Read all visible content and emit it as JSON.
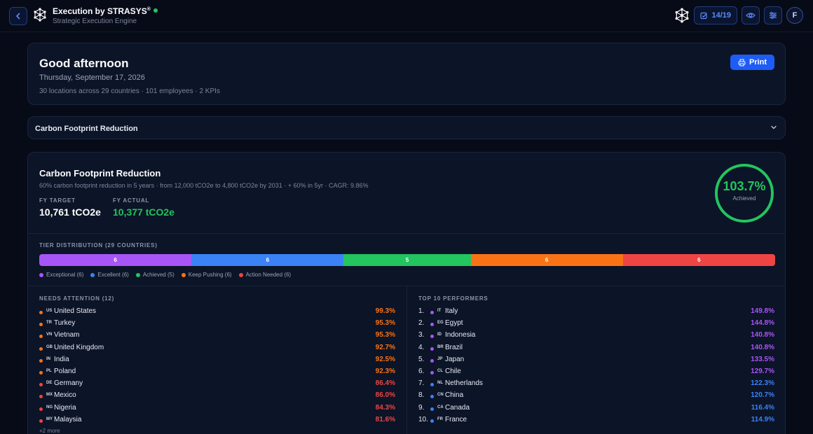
{
  "app": {
    "title": "Execution by STRASYS",
    "title_mark": "®",
    "subtitle": "Strategic Execution Engine",
    "progress": "14/19",
    "avatar_initial": "F"
  },
  "greeting": {
    "title": "Good afternoon",
    "date": "Thursday, September 17, 2026",
    "meta": "30 locations across 29 countries · 101 employees · 2 KPIs",
    "print_label": "Print"
  },
  "collapsed": {
    "title": "Carbon Footprint Reduction"
  },
  "kpi": {
    "title": "Carbon Footprint Reduction",
    "description": "60% carbon footprint reduction in 5 years  ·  from 12,000 tCO2e to 4,800 tCO2e by 2031 · + 60% in 5yr · CAGR: 9.86%",
    "target_label": "FY TARGET",
    "target_value": "10,761 tCO2e",
    "actual_label": "FY ACTUAL",
    "actual_value": "10,377 tCO2e",
    "achieved_pct": "103.7%",
    "achieved_fraction": 1.0,
    "achieved_label": "Achieved"
  },
  "tiers": {
    "label": "TIER DISTRIBUTION (29 COUNTRIES)",
    "segments": [
      {
        "count": "6",
        "value": 6,
        "color": "#a855f7",
        "legend": "Exceptional (6)"
      },
      {
        "count": "6",
        "value": 6,
        "color": "#3b82f6",
        "legend": "Excellent (6)"
      },
      {
        "count": "5",
        "value": 5,
        "color": "#22c55e",
        "legend": "Achieved (5)"
      },
      {
        "count": "6",
        "value": 6,
        "color": "#f97316",
        "legend": "Keep Pushing (6)"
      },
      {
        "count": "6",
        "value": 6,
        "color": "#ef4444",
        "legend": "Action Needed (6)"
      }
    ]
  },
  "needs_attention": {
    "label": "NEEDS ATTENTION (12)",
    "more": "+2 more",
    "items": [
      {
        "code": "US",
        "name": "United States",
        "pct": "99.3%",
        "color": "#f97316"
      },
      {
        "code": "TR",
        "name": "Turkey",
        "pct": "95.3%",
        "color": "#f97316"
      },
      {
        "code": "VN",
        "name": "Vietnam",
        "pct": "95.3%",
        "color": "#f97316"
      },
      {
        "code": "GB",
        "name": "United Kingdom",
        "pct": "92.7%",
        "color": "#f97316"
      },
      {
        "code": "IN",
        "name": "India",
        "pct": "92.5%",
        "color": "#f97316"
      },
      {
        "code": "PL",
        "name": "Poland",
        "pct": "92.3%",
        "color": "#f97316"
      },
      {
        "code": "DE",
        "name": "Germany",
        "pct": "86.4%",
        "color": "#ef4444"
      },
      {
        "code": "MX",
        "name": "Mexico",
        "pct": "86.0%",
        "color": "#ef4444"
      },
      {
        "code": "NG",
        "name": "Nigeria",
        "pct": "84.3%",
        "color": "#ef4444"
      },
      {
        "code": "MY",
        "name": "Malaysia",
        "pct": "81.6%",
        "color": "#ef4444"
      }
    ]
  },
  "top_performers": {
    "label": "TOP 10 PERFORMERS",
    "items": [
      {
        "rank": "1.",
        "code": "IT",
        "name": "Italy",
        "pct": "149.8%",
        "color": "#a855f7"
      },
      {
        "rank": "2.",
        "code": "EG",
        "name": "Egypt",
        "pct": "144.8%",
        "color": "#a855f7"
      },
      {
        "rank": "3.",
        "code": "ID",
        "name": "Indonesia",
        "pct": "140.8%",
        "color": "#a855f7"
      },
      {
        "rank": "4.",
        "code": "BR",
        "name": "Brazil",
        "pct": "140.8%",
        "color": "#a855f7"
      },
      {
        "rank": "5.",
        "code": "JP",
        "name": "Japan",
        "pct": "133.5%",
        "color": "#a855f7"
      },
      {
        "rank": "6.",
        "code": "CL",
        "name": "Chile",
        "pct": "129.7%",
        "color": "#a855f7"
      },
      {
        "rank": "7.",
        "code": "NL",
        "name": "Netherlands",
        "pct": "122.3%",
        "color": "#3b82f6"
      },
      {
        "rank": "8.",
        "code": "CN",
        "name": "China",
        "pct": "120.7%",
        "color": "#3b82f6"
      },
      {
        "rank": "9.",
        "code": "CA",
        "name": "Canada",
        "pct": "116.4%",
        "color": "#3b82f6"
      },
      {
        "rank": "10.",
        "code": "FR",
        "name": "France",
        "pct": "114.9%",
        "color": "#3b82f6"
      }
    ]
  }
}
